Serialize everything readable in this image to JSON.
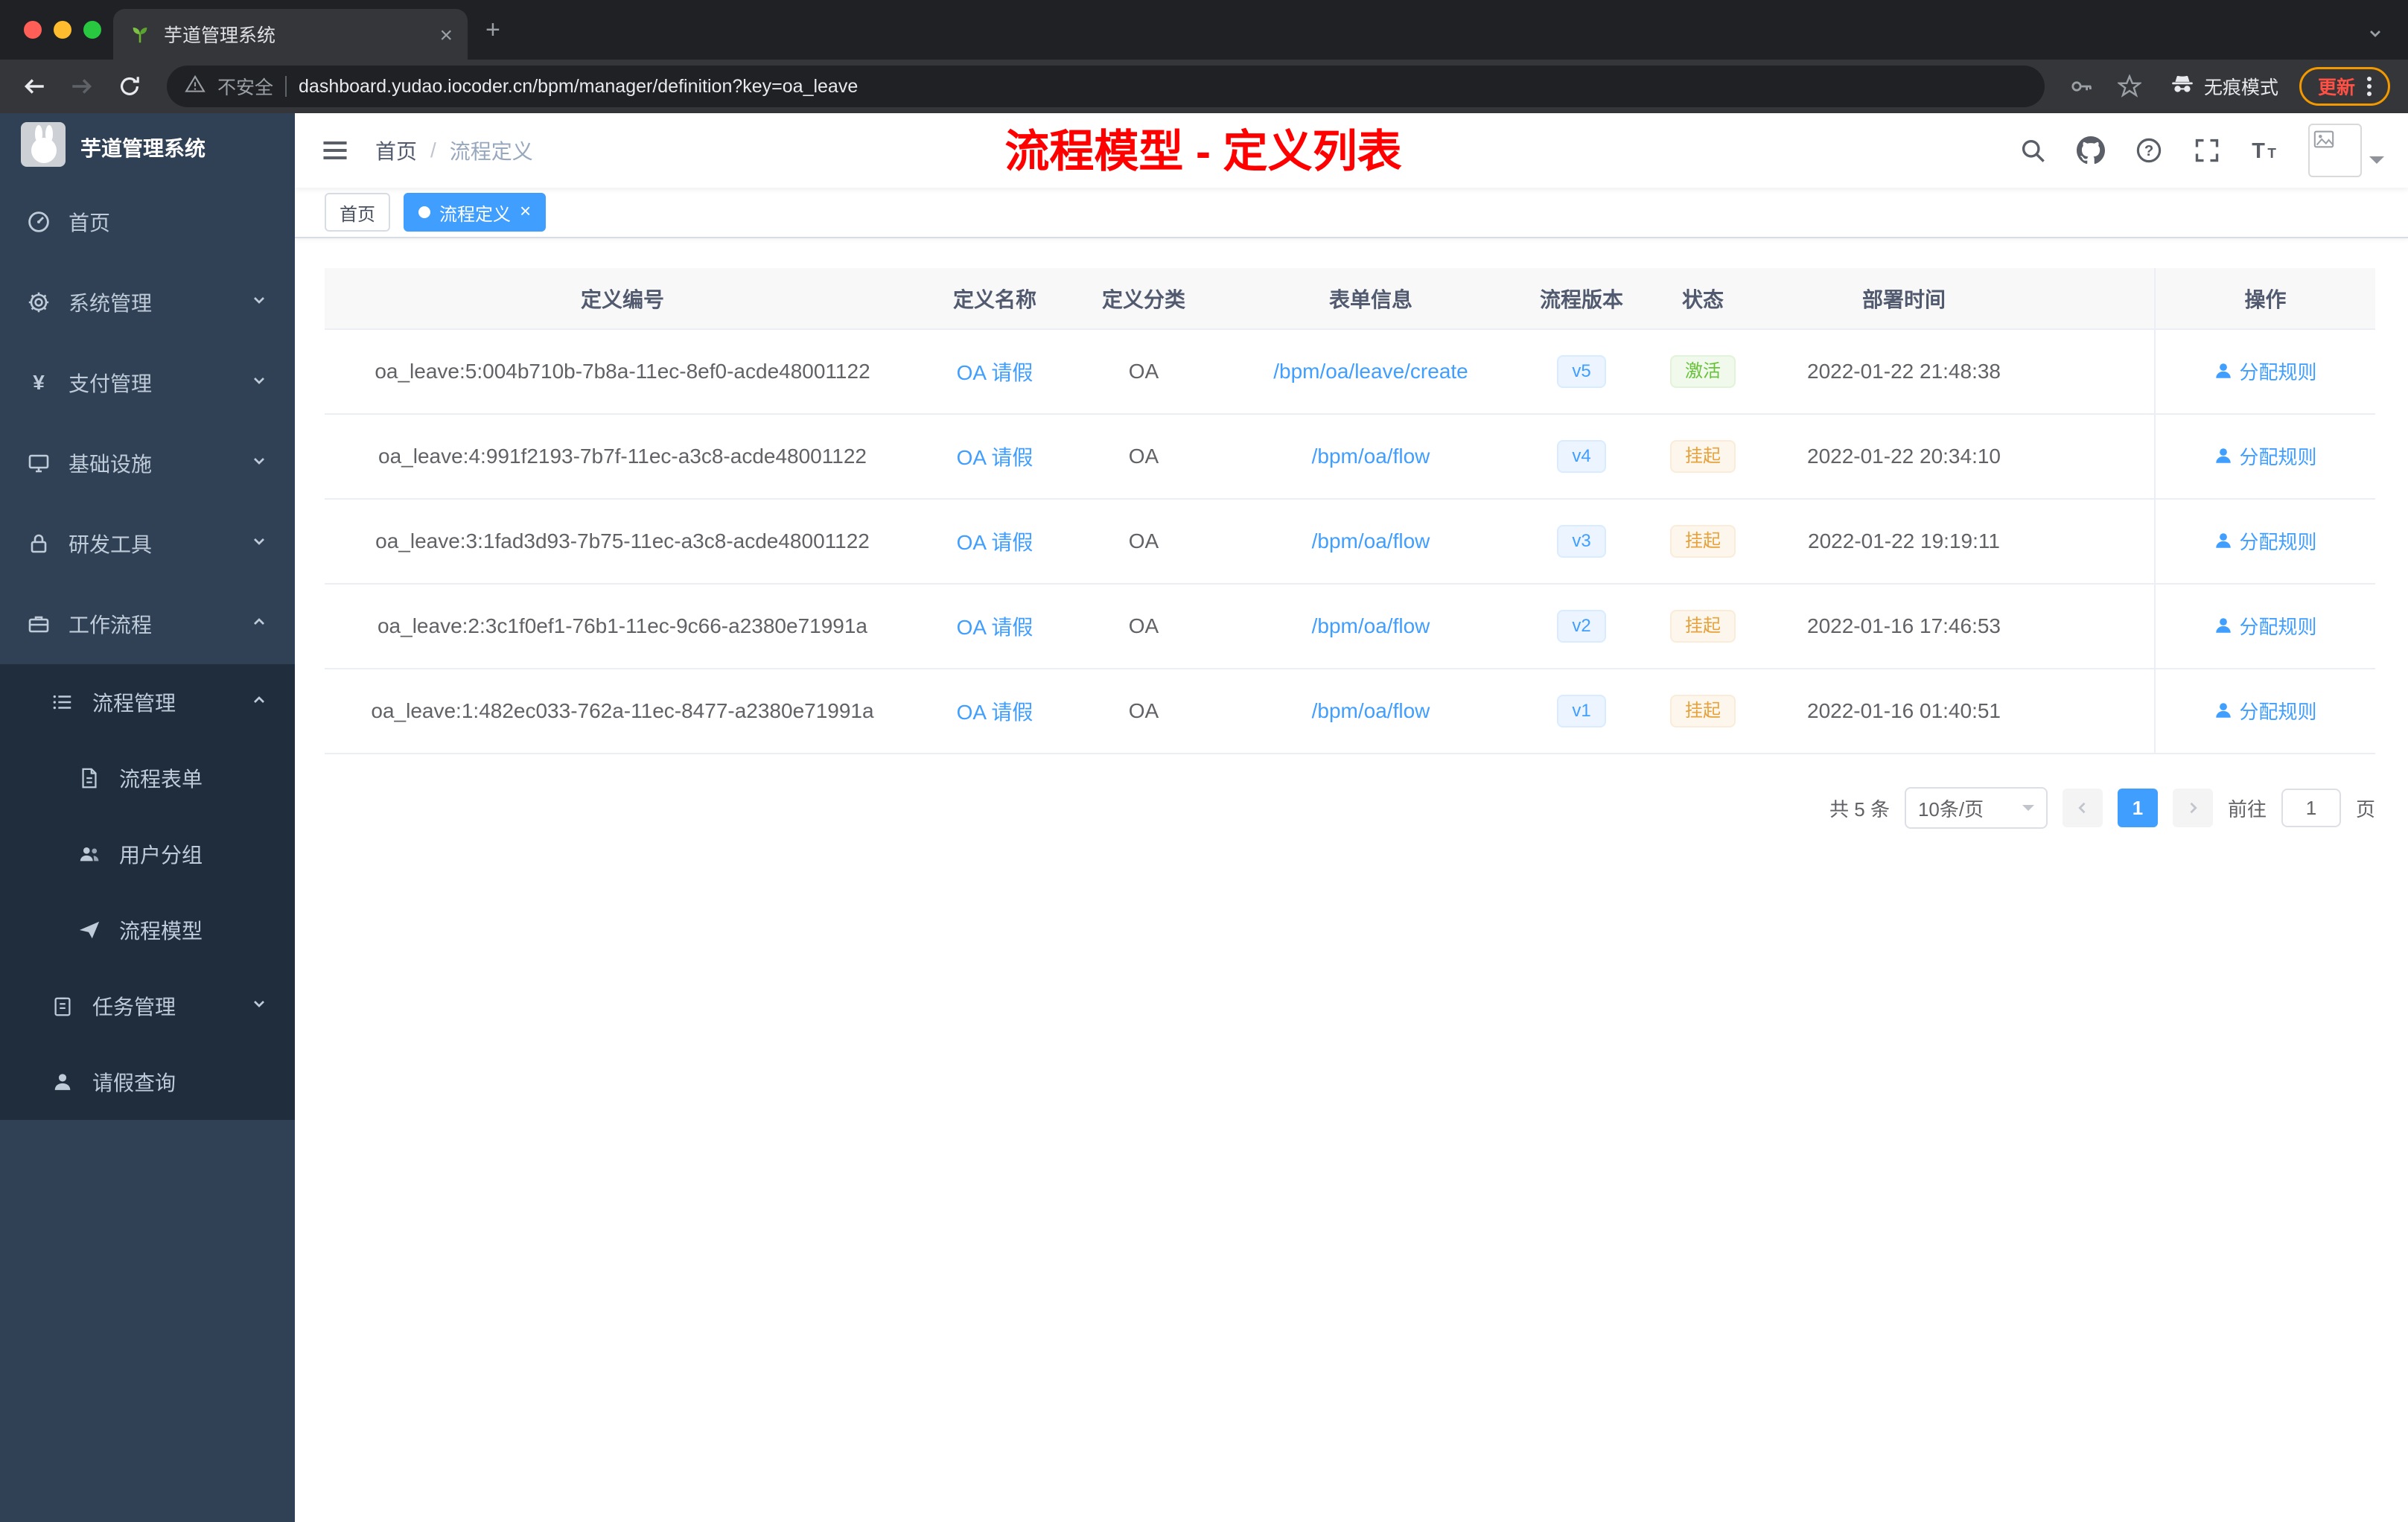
{
  "colors": {
    "accent_blue": "#409eff",
    "status_active_green": "#67c23a",
    "status_suspended_orange": "#e6a23c",
    "page_title_red": "#ff0000",
    "sidebar_bg": "#304156",
    "submenu_bg": "#1f2d3d"
  },
  "browser": {
    "tab_title": "芋道管理系统",
    "security_label": "不安全",
    "url": "dashboard.yudao.iocoder.cn/bpm/manager/definition?key=oa_leave",
    "incognito_label": "无痕模式",
    "update_label": "更新"
  },
  "sidebar": {
    "logo_title": "芋道管理系统",
    "menu": [
      {
        "label": "首页",
        "icon": "dashboard-icon"
      },
      {
        "label": "系统管理",
        "icon": "gear-icon"
      },
      {
        "label": "支付管理",
        "icon": "payment-icon"
      },
      {
        "label": "基础设施",
        "icon": "infrastructure-icon"
      },
      {
        "label": "研发工具",
        "icon": "tools-icon"
      },
      {
        "label": "工作流程",
        "icon": "workflow-icon"
      }
    ],
    "submenu": [
      {
        "label": "流程管理",
        "icon": "list-icon"
      },
      {
        "label": "流程表单",
        "icon": "form-icon"
      },
      {
        "label": "用户分组",
        "icon": "user-group-icon"
      },
      {
        "label": "流程模型",
        "icon": "paper-plane-icon"
      },
      {
        "label": "任务管理",
        "icon": "clipboard-icon"
      },
      {
        "label": "请假查询",
        "icon": "person-icon"
      }
    ]
  },
  "navbar": {
    "breadcrumb_home": "首页",
    "breadcrumb_sep": "/",
    "breadcrumb_current": "流程定义",
    "page_title": "流程模型 - 定义列表"
  },
  "tags": {
    "home_label": "首页",
    "active_label": "流程定义"
  },
  "table": {
    "headers": [
      "定义编号",
      "定义名称",
      "定义分类",
      "表单信息",
      "流程版本",
      "状态",
      "部署时间",
      "操作"
    ],
    "rows": [
      {
        "id": "oa_leave:5:004b710b-7b8a-11ec-8ef0-acde48001122",
        "name": "OA 请假",
        "category": "OA",
        "form": "/bpm/oa/leave/create",
        "version": "v5",
        "status": "激活",
        "deploy_time": "2022-01-22 21:48:38",
        "action": "分配规则"
      },
      {
        "id": "oa_leave:4:991f2193-7b7f-11ec-a3c8-acde48001122",
        "name": "OA 请假",
        "category": "OA",
        "form": "/bpm/oa/flow",
        "version": "v4",
        "status": "挂起",
        "deploy_time": "2022-01-22 20:34:10",
        "action": "分配规则"
      },
      {
        "id": "oa_leave:3:1fad3d93-7b75-11ec-a3c8-acde48001122",
        "name": "OA 请假",
        "category": "OA",
        "form": "/bpm/oa/flow",
        "version": "v3",
        "status": "挂起",
        "deploy_time": "2022-01-22 19:19:11",
        "action": "分配规则"
      },
      {
        "id": "oa_leave:2:3c1f0ef1-76b1-11ec-9c66-a2380e71991a",
        "name": "OA 请假",
        "category": "OA",
        "form": "/bpm/oa/flow",
        "version": "v2",
        "status": "挂起",
        "deploy_time": "2022-01-16 17:46:53",
        "action": "分配规则"
      },
      {
        "id": "oa_leave:1:482ec033-762a-11ec-8477-a2380e71991a",
        "name": "OA 请假",
        "category": "OA",
        "form": "/bpm/oa/flow",
        "version": "v1",
        "status": "挂起",
        "deploy_time": "2022-01-16 01:40:51",
        "action": "分配规则"
      }
    ]
  },
  "pagination": {
    "total_label": "共 5 条",
    "page_size_label": "10条/页",
    "current_page": "1",
    "goto_label": "前往",
    "goto_value": "1",
    "page_unit_label": "页"
  }
}
